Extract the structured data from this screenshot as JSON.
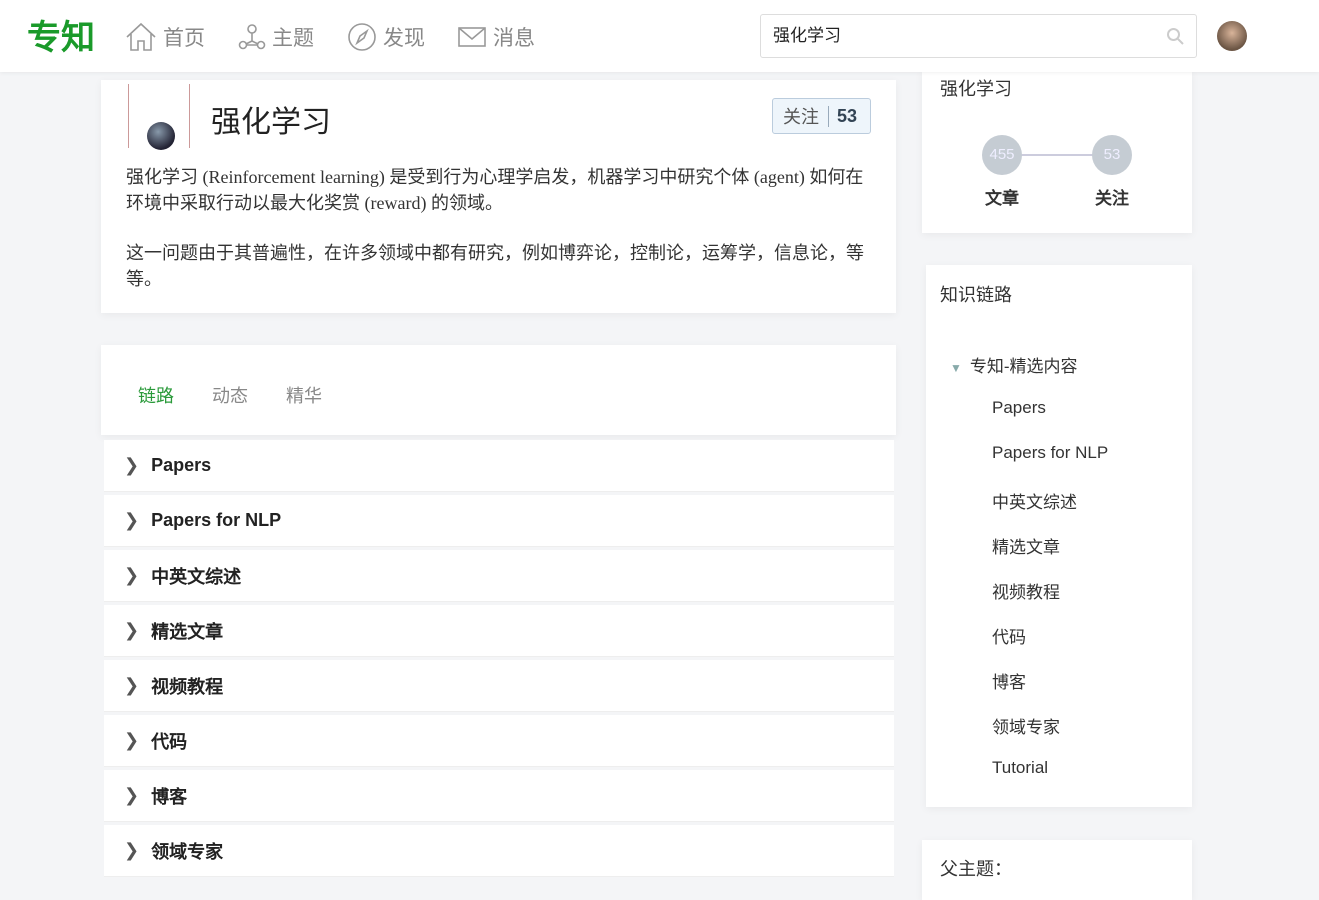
{
  "header": {
    "logo": "专知",
    "nav": [
      {
        "label": "首页",
        "icon": "home-icon"
      },
      {
        "label": "主题",
        "icon": "topic-icon"
      },
      {
        "label": "发现",
        "icon": "compass-icon"
      },
      {
        "label": "消息",
        "icon": "mail-icon"
      }
    ],
    "search_value": "强化学习"
  },
  "topic": {
    "title": "强化学习",
    "follow_label": "关注",
    "follow_count": "53",
    "desc1": "强化学习 (Reinforcement learning) 是受到行为心理学启发，机器学习中研究个体 (agent) 如何在环境中采取行动以最大化奖赏 (reward) 的领域。",
    "desc2": "这一问题由于其普遍性，在许多领域中都有研究，例如博弈论，控制论，运筹学，信息论，等等。"
  },
  "tabs": [
    "链路",
    "动态",
    "精华"
  ],
  "rows": [
    "Papers",
    "Papers for NLP",
    "中英文综述",
    "精选文章",
    "视频教程",
    "代码",
    "博客",
    "领域专家"
  ],
  "sidebar": {
    "stats_title": "强化学习",
    "articles": "455",
    "articles_label": "文章",
    "follows": "53",
    "follows_label": "关注",
    "chain_title": "知识链路",
    "tree_root": "专知-精选内容",
    "tree_items": [
      "Papers",
      "Papers for NLP",
      "中英文综述",
      "精选文章",
      "视频教程",
      "代码",
      "博客",
      "领域专家",
      "Tutorial"
    ],
    "parent_title": "父主题："
  }
}
